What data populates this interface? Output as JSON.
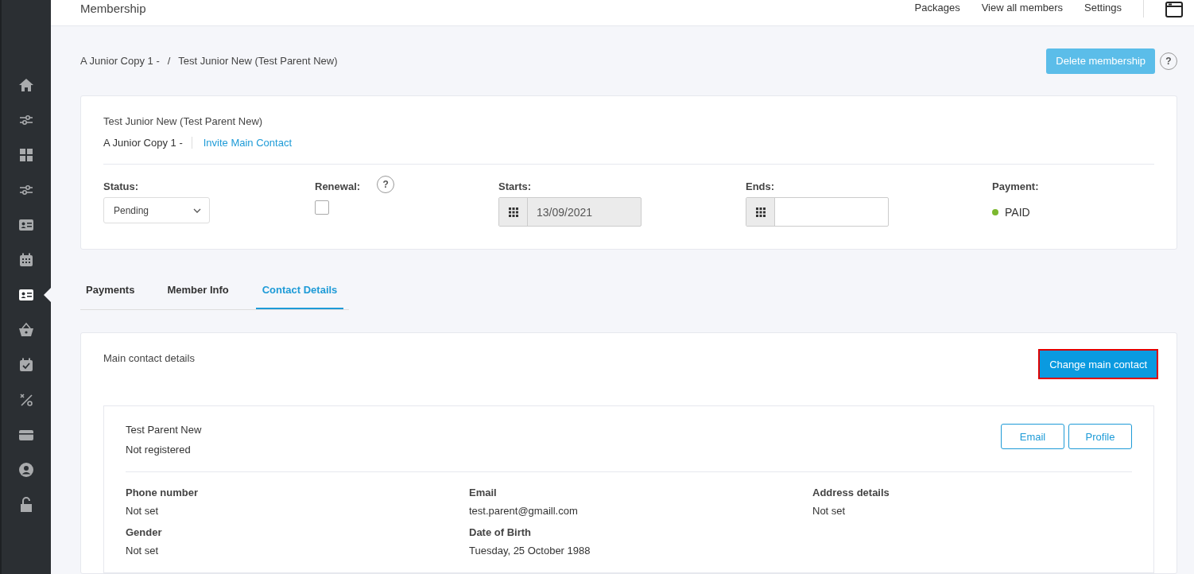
{
  "sidebar": {
    "items": [
      {
        "kind": "home",
        "selected": false
      },
      {
        "kind": "sliders",
        "selected": false
      },
      {
        "kind": "grid",
        "selected": false
      },
      {
        "kind": "sliders",
        "selected": false
      },
      {
        "kind": "contact-card",
        "selected": false
      },
      {
        "kind": "calendar",
        "selected": false
      },
      {
        "kind": "id-card",
        "selected": true
      },
      {
        "kind": "basket",
        "selected": false
      },
      {
        "kind": "calendar-check",
        "selected": false
      },
      {
        "kind": "percent",
        "selected": false
      },
      {
        "kind": "card",
        "selected": false
      },
      {
        "kind": "user",
        "selected": false
      },
      {
        "kind": "lock",
        "selected": false
      }
    ]
  },
  "header": {
    "title": "Membership",
    "links": [
      "Packages",
      "View all members",
      "Settings"
    ]
  },
  "breadcrumb": [
    "A Junior Copy 1 -",
    "Test Junior New (Test Parent New)"
  ],
  "breadcrumb_separator": "/",
  "help_glyph": "?",
  "delete_button": "Delete membership",
  "summary": {
    "name": "Test Junior New (Test Parent New)",
    "package": "A Junior Copy 1 -",
    "invite_link": "Invite Main Contact",
    "status": {
      "label": "Status:",
      "value": "Pending"
    },
    "renewal": {
      "label": "Renewal:",
      "checked": false
    },
    "starts": {
      "label": "Starts:",
      "value": "13/09/2021",
      "disabled": true
    },
    "ends": {
      "label": "Ends:",
      "disabled": false
    },
    "payment": {
      "label": "Payment:",
      "value": "PAID",
      "color": "#7cb82f"
    }
  },
  "tabs": [
    {
      "label": "Payments",
      "selected": false
    },
    {
      "label": "Member Info",
      "selected": false
    },
    {
      "label": "Contact Details",
      "selected": true
    }
  ],
  "contact": {
    "heading": "Main contact details",
    "change_button": {
      "label": "Change main contact",
      "highlighted": true
    },
    "name": "Test Parent New",
    "registration": "Not registered",
    "buttons": [
      "Email",
      "Profile"
    ],
    "fields": [
      {
        "label": "Phone number",
        "value": "Not set"
      },
      {
        "label": "Email",
        "value": "test.parent@gmaill.com"
      },
      {
        "label": "Address details",
        "value": "Not set"
      },
      {
        "label": "Gender",
        "value": "Not set"
      },
      {
        "label": "Date of Birth",
        "value": "Tuesday, 25 October 1988"
      }
    ]
  }
}
